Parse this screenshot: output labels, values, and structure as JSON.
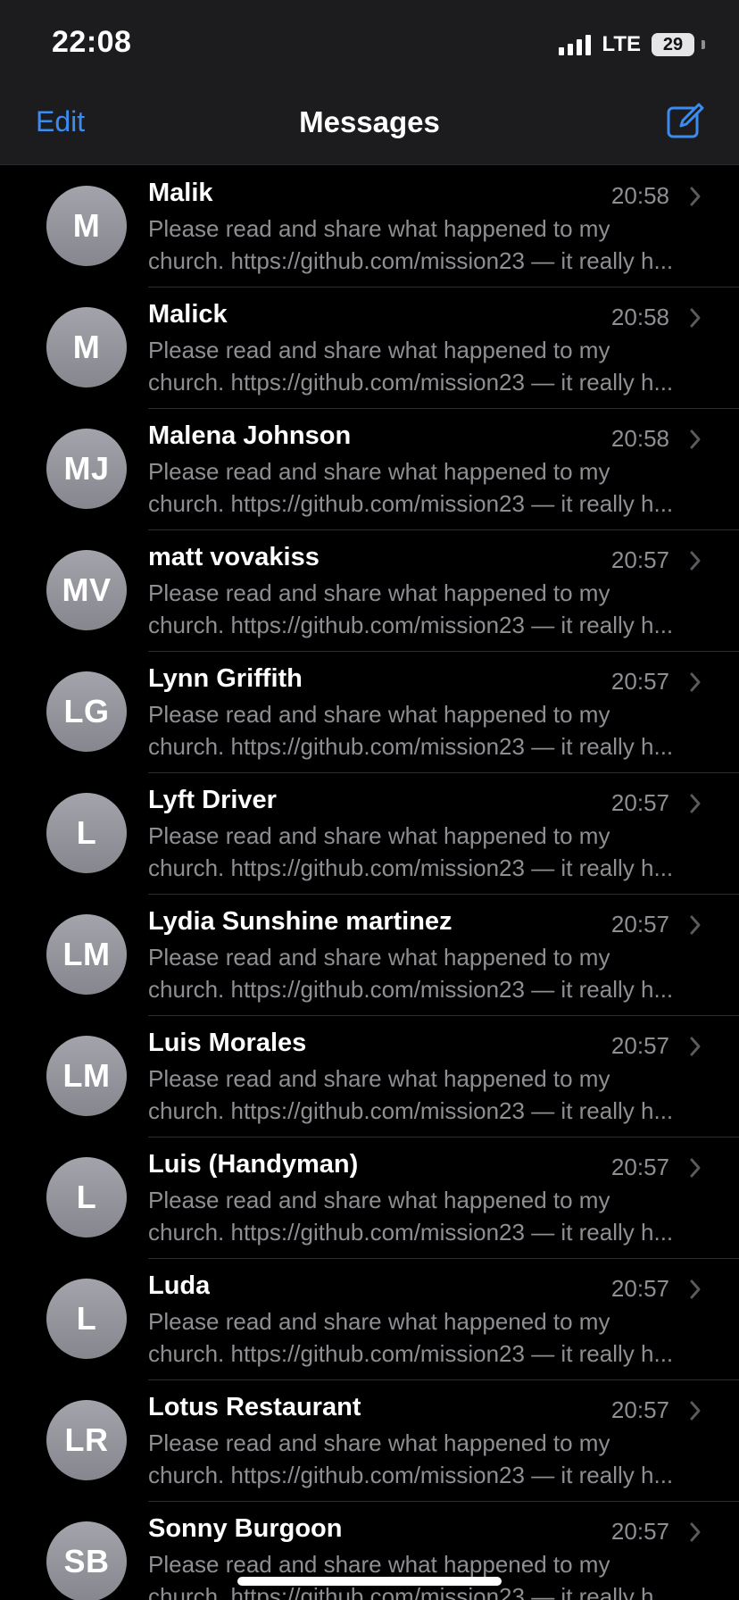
{
  "status": {
    "time": "22:08",
    "network": "LTE",
    "battery": "29"
  },
  "nav": {
    "edit": "Edit",
    "title": "Messages",
    "compose_icon": "compose-icon"
  },
  "colors": {
    "accent": "#3b8cf0",
    "background": "#000000",
    "secondary_text": "#8e8e93"
  },
  "conversations": [
    {
      "initials": "M",
      "name": "Malik",
      "time": "20:58",
      "preview_line1": "Please read and share what happened to my",
      "preview_line2": "church. https://github.com/mission23 — it really h..."
    },
    {
      "initials": "M",
      "name": "Malick",
      "time": "20:58",
      "preview_line1": "Please read and share what happened to my",
      "preview_line2": "church. https://github.com/mission23 — it really h..."
    },
    {
      "initials": "MJ",
      "name": "Malena Johnson",
      "time": "20:58",
      "preview_line1": "Please read and share what happened to my",
      "preview_line2": "church. https://github.com/mission23 — it really h..."
    },
    {
      "initials": "MV",
      "name": "matt vovakiss",
      "time": "20:57",
      "preview_line1": "Please read and share what happened to my",
      "preview_line2": "church. https://github.com/mission23 — it really h..."
    },
    {
      "initials": "LG",
      "name": "Lynn Griffith",
      "time": "20:57",
      "preview_line1": "Please read and share what happened to my",
      "preview_line2": "church. https://github.com/mission23 — it really h..."
    },
    {
      "initials": "L",
      "name": "Lyft Driver",
      "time": "20:57",
      "preview_line1": "Please read and share what happened to my",
      "preview_line2": "church. https://github.com/mission23 — it really h..."
    },
    {
      "initials": "LM",
      "name": "Lydia Sunshine martinez",
      "time": "20:57",
      "preview_line1": "Please read and share what happened to my",
      "preview_line2": "church. https://github.com/mission23 — it really h..."
    },
    {
      "initials": "LM",
      "name": "Luis Morales",
      "time": "20:57",
      "preview_line1": "Please read and share what happened to my",
      "preview_line2": "church. https://github.com/mission23 — it really h..."
    },
    {
      "initials": "L",
      "name": "Luis (Handyman)",
      "time": "20:57",
      "preview_line1": "Please read and share what happened to my",
      "preview_line2": "church. https://github.com/mission23 — it really h..."
    },
    {
      "initials": "L",
      "name": "Luda",
      "time": "20:57",
      "preview_line1": "Please read and share what happened to my",
      "preview_line2": "church. https://github.com/mission23 — it really h..."
    },
    {
      "initials": "LR",
      "name": "Lotus Restaurant",
      "time": "20:57",
      "preview_line1": "Please read and share what happened to my",
      "preview_line2": "church. https://github.com/mission23 — it really h..."
    },
    {
      "initials": "SB",
      "name": "Sonny Burgoon",
      "time": "20:57",
      "preview_line1": "Please read and share what happened to my",
      "preview_line2": "church. https://github.com/mission23 — it really h..."
    }
  ]
}
